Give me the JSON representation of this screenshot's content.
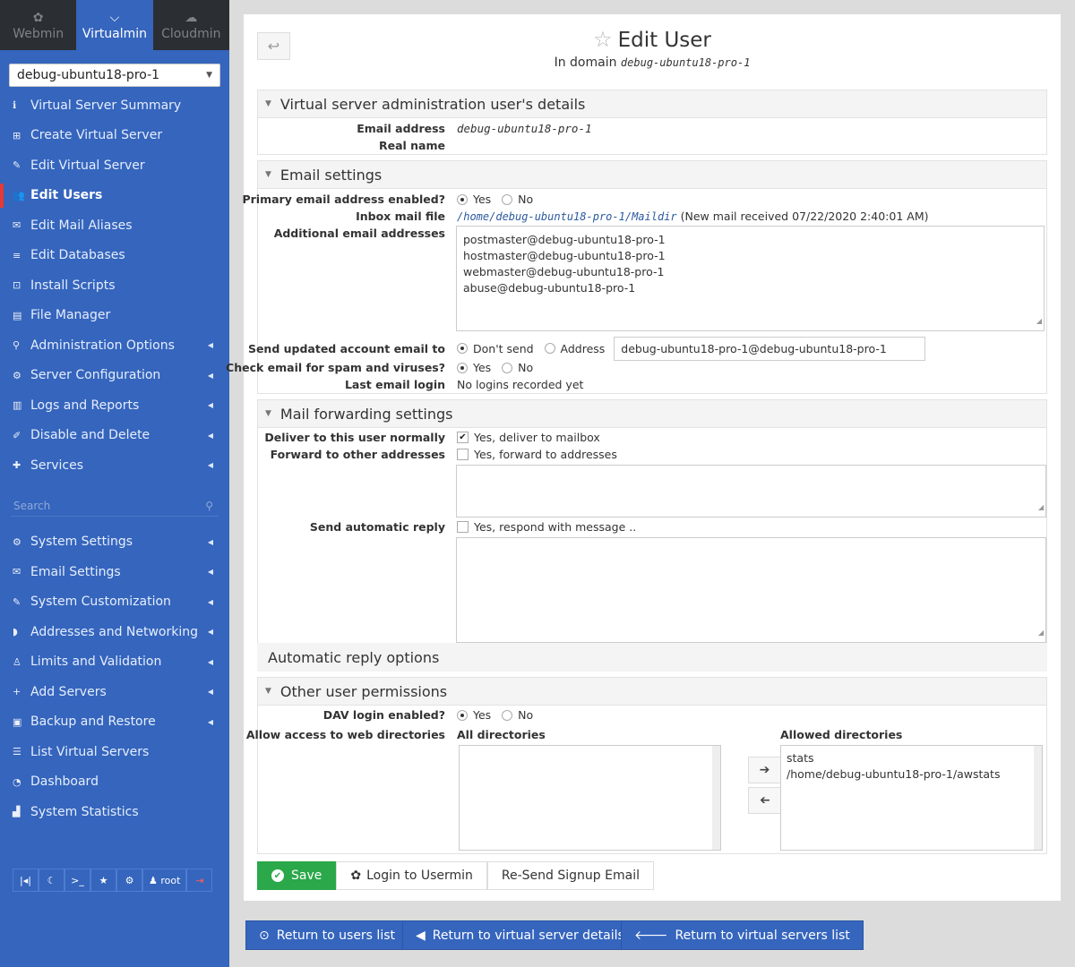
{
  "switcher": [
    {
      "label": "Webmin",
      "icon": "webmin-icon",
      "glyph": "✿"
    },
    {
      "label": "Virtualmin",
      "icon": "virtualmin-icon",
      "glyph": "⌵"
    },
    {
      "label": "Cloudmin",
      "icon": "cloudmin-icon",
      "glyph": "☁"
    }
  ],
  "domain_select": "debug-ubuntu18-pro-1",
  "menu": [
    {
      "label": "Virtual Server Summary",
      "glyph": "ℹ"
    },
    {
      "label": "Create Virtual Server",
      "glyph": "⊞"
    },
    {
      "label": "Edit Virtual Server",
      "glyph": "✎"
    },
    {
      "label": "Edit Users",
      "glyph": "👥"
    },
    {
      "label": "Edit Mail Aliases",
      "glyph": "✉"
    },
    {
      "label": "Edit Databases",
      "glyph": "≡"
    },
    {
      "label": "Install Scripts",
      "glyph": "⊡"
    },
    {
      "label": "File Manager",
      "glyph": "▤"
    },
    {
      "label": "Administration Options",
      "glyph": "⚲"
    },
    {
      "label": "Server Configuration",
      "glyph": "⚙"
    },
    {
      "label": "Logs and Reports",
      "glyph": "▥"
    },
    {
      "label": "Disable and Delete",
      "glyph": "✐"
    },
    {
      "label": "Services",
      "glyph": "✚"
    }
  ],
  "search_placeholder": "Search",
  "menu2": [
    {
      "label": "System Settings",
      "glyph": "⚙"
    },
    {
      "label": "Email Settings",
      "glyph": "✉"
    },
    {
      "label": "System Customization",
      "glyph": "✎"
    },
    {
      "label": "Addresses and Networking",
      "glyph": "◗"
    },
    {
      "label": "Limits and Validation",
      "glyph": "♙"
    },
    {
      "label": "Add Servers",
      "glyph": "+"
    },
    {
      "label": "Backup and Restore",
      "glyph": "▣"
    },
    {
      "label": "List Virtual Servers",
      "glyph": "☰"
    },
    {
      "label": "Dashboard",
      "glyph": "◔"
    },
    {
      "label": "System Statistics",
      "glyph": "▟"
    }
  ],
  "bottom_user": "root",
  "page": {
    "title": "Edit User",
    "subtitle_prefix": "In domain",
    "subtitle_domain": "debug-ubuntu18-pro-1"
  },
  "admin_section": {
    "title": "Virtual server administration user's details",
    "email_label": "Email address",
    "email_value": "debug-ubuntu18-pro-1",
    "realname_label": "Real name"
  },
  "email_section": {
    "title": "Email settings",
    "primary_label": "Primary email address enabled?",
    "yes": "Yes",
    "no": "No",
    "inbox_label": "Inbox mail file",
    "inbox_path": "/home/debug-ubuntu18-pro-1/Maildir",
    "inbox_note": "(New mail received 07/22/2020 2:40:01 AM)",
    "additional_label": "Additional email addresses",
    "additional": [
      "postmaster@debug-ubuntu18-pro-1",
      "hostmaster@debug-ubuntu18-pro-1",
      "webmaster@debug-ubuntu18-pro-1",
      "abuse@debug-ubuntu18-pro-1"
    ],
    "send_label": "Send updated account email to",
    "dont_send": "Don't send",
    "address": "Address",
    "address_value": "debug-ubuntu18-pro-1@debug-ubuntu18-pro-1",
    "spam_label": "Check email for spam and viruses?",
    "last_label": "Last email login",
    "last_value": "No logins recorded yet"
  },
  "forward_section": {
    "title": "Mail forwarding settings",
    "deliver_label": "Deliver to this user normally",
    "deliver_opt": "Yes, deliver to mailbox",
    "forward_label": "Forward to other addresses",
    "forward_opt": "Yes, forward to addresses",
    "auto_label": "Send automatic reply",
    "auto_opt": "Yes, respond with message .."
  },
  "auto_reply_options": "Automatic reply options",
  "perm_section": {
    "title": "Other user permissions",
    "dav_label": "DAV login enabled?",
    "yes": "Yes",
    "no": "No",
    "web_label": "Allow access to web directories",
    "all_dirs": "All directories",
    "allowed_dirs": "Allowed directories",
    "allowed_items": [
      "/home/debug-ubuntu18-pro-1/awstats",
      "stats"
    ]
  },
  "actions": {
    "save": "Save",
    "login_usermin": "Login to Usermin",
    "resend": "Re-Send Signup Email"
  },
  "footer": {
    "users": "Return to users list",
    "details": "Return to virtual server details",
    "servers": "Return to virtual servers list"
  }
}
